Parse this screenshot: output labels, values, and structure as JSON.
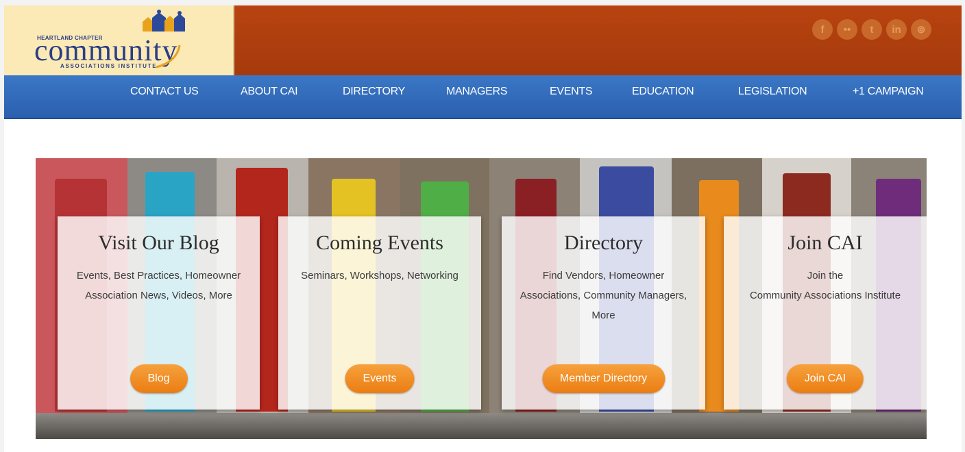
{
  "header": {
    "logo": {
      "chapter": "HEARTLAND CHAPTER",
      "word": "community",
      "institute": "ASSOCIATIONS INSTITUTE"
    },
    "social": [
      {
        "icon": "facebook-icon",
        "glyph": "f"
      },
      {
        "icon": "flickr-icon",
        "glyph": "••"
      },
      {
        "icon": "twitter-icon",
        "glyph": "t"
      },
      {
        "icon": "linkedin-icon",
        "glyph": "in"
      },
      {
        "icon": "rss-icon",
        "glyph": "⊚"
      }
    ]
  },
  "nav": {
    "contact": "CONTACT US",
    "about": "ABOUT CAI",
    "directory": "DIRECTORY",
    "managers": "MANAGERS",
    "events": "EVENTS",
    "education": "EDUCATION",
    "legislation": "LEGISLATION",
    "campaign": "+1 CAMPAIGN"
  },
  "cards": {
    "blog": {
      "title": "Visit Our Blog",
      "line1": "Events, Best Practices, Homeowner",
      "line2": "Association News, Videos, More",
      "button": "Blog"
    },
    "events": {
      "title": "Coming Events",
      "line1": "Seminars, Workshops, Networking",
      "button": "Events"
    },
    "directory": {
      "title": "Directory",
      "line1": "Find Vendors, Homeowner",
      "line2": "Associations, Community Managers,",
      "line3": "More",
      "button": "Member Directory"
    },
    "join": {
      "title": "Join CAI",
      "line1": "Join the",
      "line2": "Community Associations Institute",
      "button": "Join CAI"
    }
  },
  "colors": {
    "topbar": "#b84310",
    "logo_bg": "#fbe9b6",
    "nav": "#2f68b6",
    "button": "#f0891f",
    "logo_text": "#2b3e85"
  }
}
